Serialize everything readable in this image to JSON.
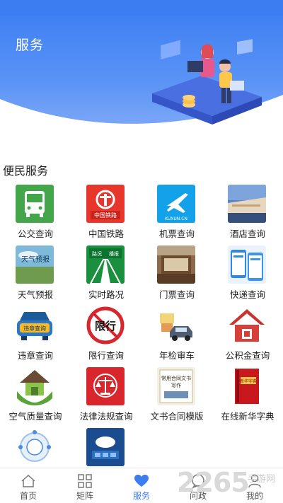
{
  "header": {
    "title": "服务"
  },
  "section": {
    "title": "便民服务"
  },
  "services": [
    {
      "label": "公交查询",
      "icon": "bus-icon"
    },
    {
      "label": "中国铁路",
      "icon": "china-railway-icon"
    },
    {
      "label": "机票查询",
      "icon": "airplane-icon"
    },
    {
      "label": "酒店查询",
      "icon": "hotel-icon"
    },
    {
      "label": "天气预报",
      "icon": "weather-icon"
    },
    {
      "label": "实时路况",
      "icon": "road-condition-icon"
    },
    {
      "label": "门票查询",
      "icon": "ticket-icon"
    },
    {
      "label": "快递查询",
      "icon": "express-icon"
    },
    {
      "label": "违章查询",
      "icon": "violation-icon"
    },
    {
      "label": "限行查询",
      "icon": "traffic-restriction-icon"
    },
    {
      "label": "年检审车",
      "icon": "car-inspection-icon"
    },
    {
      "label": "公积金查询",
      "icon": "housing-fund-icon"
    },
    {
      "label": "空气质量查询",
      "icon": "air-quality-icon"
    },
    {
      "label": "法律法规查询",
      "icon": "law-icon"
    },
    {
      "label": "文书合同模版",
      "icon": "contract-template-icon"
    },
    {
      "label": "在线新华字典",
      "icon": "dictionary-icon"
    },
    {
      "label": "",
      "icon": "government-service-icon"
    },
    {
      "label": "",
      "icon": "cloud-service-icon"
    }
  ],
  "icon_texts": {
    "railway": "中国铁路",
    "airline": "KUXUN.CN",
    "weather": "天气预报",
    "road_left": "路况",
    "road_right": "播报",
    "violation": "违章查询",
    "restriction": "限行",
    "contract_line1": "常用合同文书",
    "contract_line2": "写作",
    "dictionary": "新华字典"
  },
  "tabs": [
    {
      "label": "首页",
      "icon": "home-icon",
      "active": false
    },
    {
      "label": "矩阵",
      "icon": "grid-icon",
      "active": false
    },
    {
      "label": "服务",
      "icon": "heart-icon",
      "active": true
    },
    {
      "label": "问政",
      "icon": "chat-icon",
      "active": false
    },
    {
      "label": "我的",
      "icon": "user-icon",
      "active": false
    }
  ],
  "watermark": {
    "number": "2265",
    "text": "手游网"
  },
  "colors": {
    "brand": "#3c7ef2",
    "hero": "#5b94f6"
  }
}
